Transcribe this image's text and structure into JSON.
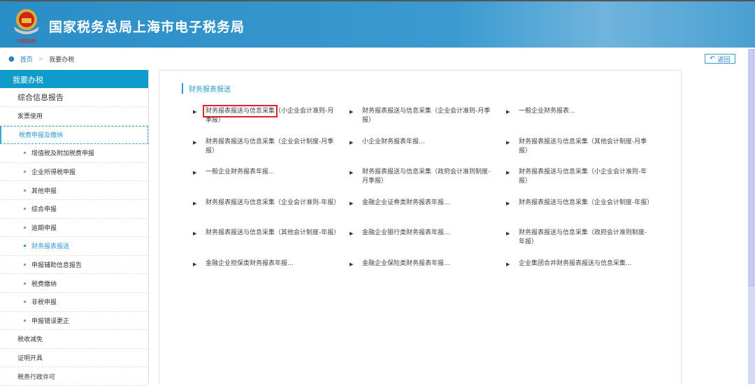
{
  "header": {
    "title": "国家税务总局上海市电子税务局",
    "logo_text": "中国税务"
  },
  "breadcrumb": {
    "home": "首页",
    "current": "我要办税"
  },
  "back_label": "返回",
  "sidebar": {
    "head": "我要办税",
    "items": [
      "综合信息报告",
      "发票使用",
      "税费申报及缴纳"
    ],
    "sub_items": [
      "增值税及附加税费申报",
      "企业所得税申报",
      "其他申报",
      "综合申报",
      "逾期申报",
      "财务报表报送",
      "申报辅助信息报告",
      "税费缴纳",
      "非税申报",
      "申报错误更正"
    ],
    "bottom_items": [
      "税收减免",
      "证明开具",
      "税务行政许可"
    ]
  },
  "panel": {
    "title": "财务报表报送",
    "items": [
      {
        "part1": "财务报表报送与信息采集",
        "part2": "（小企业会计准则-月季报）"
      },
      {
        "part1": "财务报表报送与信息采集（企业会计准则-月季报）",
        "part2": ""
      },
      {
        "part1": "一般企业财务报表...",
        "part2": ""
      },
      {
        "part1": "财务报表报送与信息采集（企业会计制度-月季报）",
        "part2": ""
      },
      {
        "part1": "小企业财务报表年报...",
        "part2": ""
      },
      {
        "part1": "财务报表报送与信息采集（其他会计制度-月季报）",
        "part2": ""
      },
      {
        "part1": "一般企业财务报表年报...",
        "part2": ""
      },
      {
        "part1": "财务报表报送与信息采集（政府会计准则制度-月季报）",
        "part2": ""
      },
      {
        "part1": "财务报表报送与信息采集（小企业会计准则-年报）",
        "part2": ""
      },
      {
        "part1": "财务报表报送与信息采集（企业会计准则-年报）",
        "part2": ""
      },
      {
        "part1": "金融企业证券类财务报表年报...",
        "part2": ""
      },
      {
        "part1": "财务报表报送与信息采集（企业会计制度-年报）",
        "part2": ""
      },
      {
        "part1": "财务报表报送与信息采集（其他会计制度-年报）",
        "part2": ""
      },
      {
        "part1": "金融企业银行类财务报表年报...",
        "part2": ""
      },
      {
        "part1": "财务报表报送与信息采集（政府会计准则制度-年报）",
        "part2": ""
      },
      {
        "part1": "金融企业担保类财务报表年报...",
        "part2": ""
      },
      {
        "part1": "金融企业保险类财务报表年报...",
        "part2": ""
      },
      {
        "part1": "企业集团合并财务报表报送与信息采集...",
        "part2": ""
      }
    ]
  },
  "colors": {
    "brand": "#0f9ccb",
    "highlight": "#e0202a"
  }
}
